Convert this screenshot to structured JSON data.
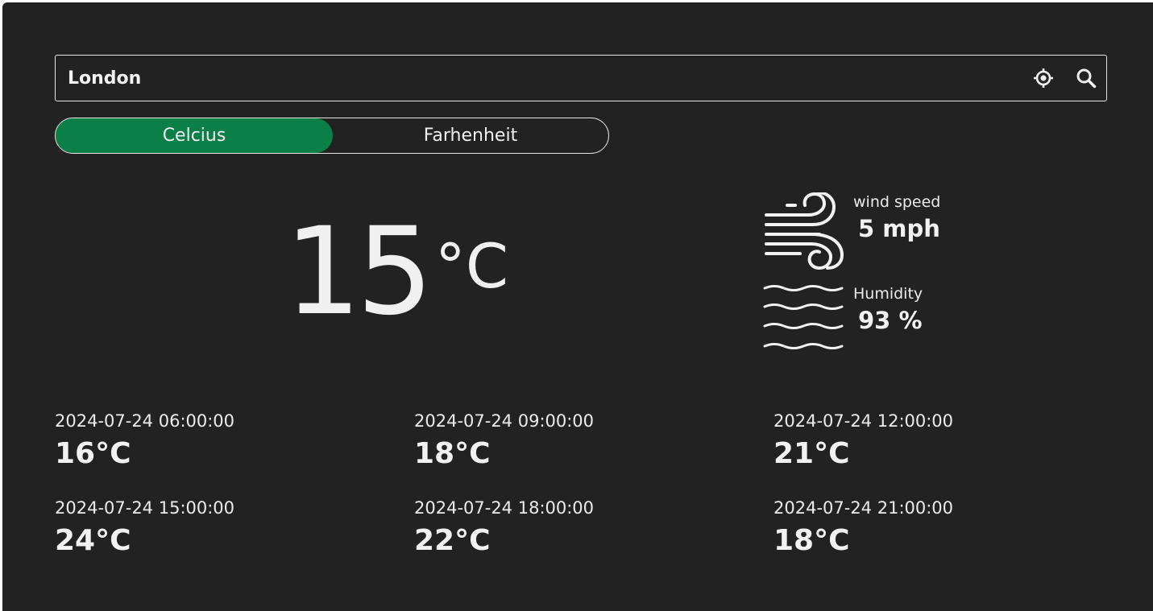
{
  "search": {
    "value": "London",
    "locate_icon": "crosshair-location-icon",
    "search_icon": "search-icon"
  },
  "units": {
    "celsius_label": "Celcius",
    "fahrenheit_label": "Farhenheit",
    "selected": "Celcius"
  },
  "current": {
    "temperature": "15",
    "unit": "°C"
  },
  "stats": {
    "wind": {
      "icon": "wind-icon",
      "label": "wind speed",
      "value": "5 mph"
    },
    "humidity": {
      "icon": "humidity-waves-icon",
      "label": "Humidity",
      "value": "93 %"
    }
  },
  "forecast": [
    {
      "time": "2024-07-24 06:00:00",
      "temp": "16°C"
    },
    {
      "time": "2024-07-24 09:00:00",
      "temp": "18°C"
    },
    {
      "time": "2024-07-24 12:00:00",
      "temp": "21°C"
    },
    {
      "time": "2024-07-24 15:00:00",
      "temp": "24°C"
    },
    {
      "time": "2024-07-24 18:00:00",
      "temp": "22°C"
    },
    {
      "time": "2024-07-24 21:00:00",
      "temp": "18°C"
    }
  ],
  "colors": {
    "background": "#222222",
    "accent": "#0a8048",
    "text": "#f0f0f0"
  }
}
